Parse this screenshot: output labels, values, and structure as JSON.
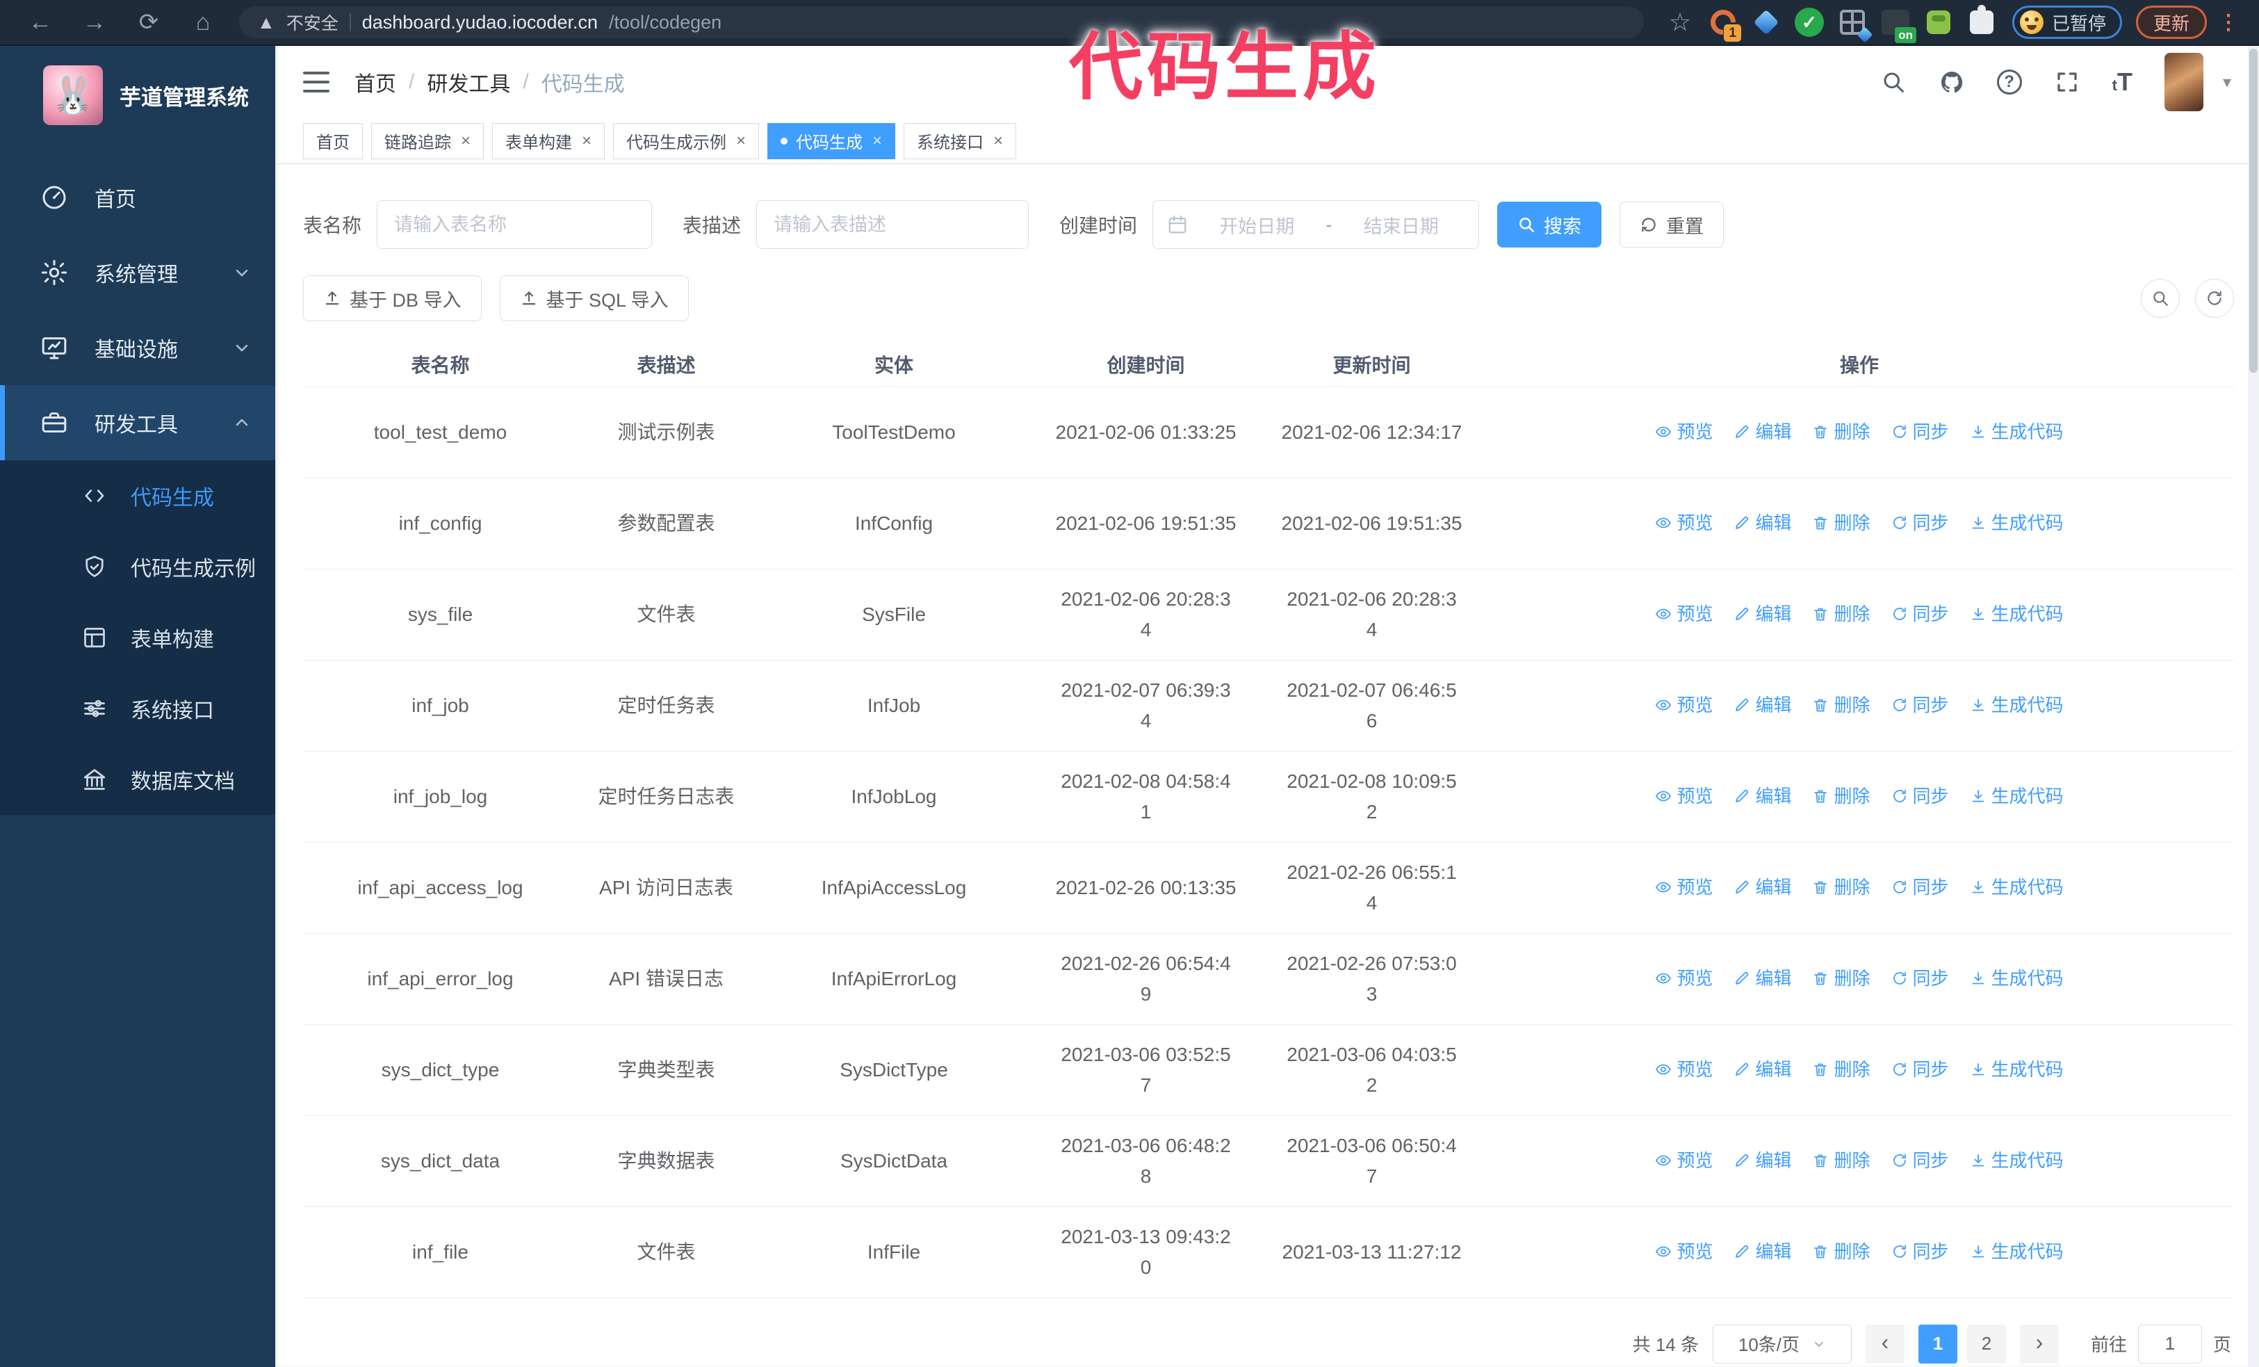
{
  "browser": {
    "security_label": "不安全",
    "url_host": "dashboard.yudao.iocoder.cn",
    "url_path": "/tool/codegen",
    "extension_badge_count": "1",
    "extension_badge_on": "on",
    "paused_badge_label": "已暂停",
    "update_button_label": "更新"
  },
  "overlay": {
    "title": "代码生成"
  },
  "sidebar": {
    "app_title": "芋道管理系统",
    "logo_glyph": "🐰",
    "items": [
      {
        "key": "home",
        "label": "首页",
        "icon": "dashboard-icon",
        "expandable": false
      },
      {
        "key": "system",
        "label": "系统管理",
        "icon": "gear-icon",
        "expandable": true
      },
      {
        "key": "infra",
        "label": "基础设施",
        "icon": "monitor-icon",
        "expandable": true
      },
      {
        "key": "devtools",
        "label": "研发工具",
        "icon": "toolbox-icon",
        "expandable": true,
        "expanded": true,
        "active": true
      }
    ],
    "sub_items": [
      {
        "key": "codegen",
        "label": "代码生成",
        "icon": "code-icon",
        "active": true
      },
      {
        "key": "codegen-example",
        "label": "代码生成示例",
        "icon": "shield-check-icon"
      },
      {
        "key": "form-builder",
        "label": "表单构建",
        "icon": "form-icon"
      },
      {
        "key": "system-api",
        "label": "系统接口",
        "icon": "sliders-icon"
      },
      {
        "key": "db-doc",
        "label": "数据库文档",
        "icon": "database-icon"
      }
    ]
  },
  "header": {
    "breadcrumb": [
      "首页",
      "研发工具",
      "代码生成"
    ],
    "breadcrumb_separator": "/"
  },
  "tabs": {
    "close_glyph": "×",
    "items": [
      {
        "key": "home",
        "label": "首页",
        "closable": false,
        "active": false
      },
      {
        "key": "tracer",
        "label": "链路追踪",
        "closable": true,
        "active": false
      },
      {
        "key": "form-builder",
        "label": "表单构建",
        "closable": true,
        "active": false
      },
      {
        "key": "codegen-example",
        "label": "代码生成示例",
        "closable": true,
        "active": false
      },
      {
        "key": "codegen",
        "label": "代码生成",
        "closable": true,
        "active": true
      },
      {
        "key": "system-api",
        "label": "系统接口",
        "closable": true,
        "active": false
      }
    ]
  },
  "filters": {
    "name_label": "表名称",
    "name_placeholder": "请输入表名称",
    "desc_label": "表描述",
    "desc_placeholder": "请输入表描述",
    "time_label": "创建时间",
    "start_placeholder": "开始日期",
    "range_separator": "-",
    "end_placeholder": "结束日期",
    "search_label": "搜索",
    "reset_label": "重置"
  },
  "toolbar": {
    "import_db_label": "基于 DB 导入",
    "import_sql_label": "基于 SQL 导入"
  },
  "table": {
    "columns": [
      "表名称",
      "表描述",
      "实体",
      "创建时间",
      "更新时间",
      "操作"
    ],
    "actions": [
      {
        "key": "preview",
        "label": "预览",
        "icon": "eye-icon"
      },
      {
        "key": "edit",
        "label": "编辑",
        "icon": "edit-icon"
      },
      {
        "key": "delete",
        "label": "删除",
        "icon": "delete-icon"
      },
      {
        "key": "sync",
        "label": "同步",
        "icon": "sync-icon"
      },
      {
        "key": "generate",
        "label": "生成代码",
        "icon": "download-icon"
      }
    ],
    "rows": [
      {
        "name": "tool_test_demo",
        "desc": "测试示例表",
        "entity": "ToolTestDemo",
        "created": "2021-02-06 01:33:25",
        "updated": "2021-02-06 12:34:17"
      },
      {
        "name": "inf_config",
        "desc": "参数配置表",
        "entity": "InfConfig",
        "created": "2021-02-06 19:51:35",
        "updated": "2021-02-06 19:51:35"
      },
      {
        "name": "sys_file",
        "desc": "文件表",
        "entity": "SysFile",
        "created": "2021-02-06 20:28:3\n4",
        "updated": "2021-02-06 20:28:3\n4"
      },
      {
        "name": "inf_job",
        "desc": "定时任务表",
        "entity": "InfJob",
        "created": "2021-02-07 06:39:3\n4",
        "updated": "2021-02-07 06:46:5\n6"
      },
      {
        "name": "inf_job_log",
        "desc": "定时任务日志表",
        "entity": "InfJobLog",
        "created": "2021-02-08 04:58:4\n1",
        "updated": "2021-02-08 10:09:5\n2"
      },
      {
        "name": "inf_api_access_log",
        "desc": "API 访问日志表",
        "entity": "InfApiAccessLog",
        "created": "2021-02-26 00:13:35",
        "updated": "2021-02-26 06:55:1\n4"
      },
      {
        "name": "inf_api_error_log",
        "desc": "API 错误日志",
        "entity": "InfApiErrorLog",
        "created": "2021-02-26 06:54:4\n9",
        "updated": "2021-02-26 07:53:0\n3"
      },
      {
        "name": "sys_dict_type",
        "desc": "字典类型表",
        "entity": "SysDictType",
        "created": "2021-03-06 03:52:5\n7",
        "updated": "2021-03-06 04:03:5\n2"
      },
      {
        "name": "sys_dict_data",
        "desc": "字典数据表",
        "entity": "SysDictData",
        "created": "2021-03-06 06:48:2\n8",
        "updated": "2021-03-06 06:50:4\n7"
      },
      {
        "name": "inf_file",
        "desc": "文件表",
        "entity": "InfFile",
        "created": "2021-03-13 09:43:2\n0",
        "updated": "2021-03-13 11:27:12"
      }
    ]
  },
  "pagination": {
    "total_label": "共 14 条",
    "page_size": "10条/页",
    "pages": [
      "1",
      "2"
    ],
    "active_page": "1",
    "prev_glyph": "‹",
    "next_glyph": "›",
    "goto_label": "前往",
    "goto_value": "1",
    "goto_suffix": "页"
  },
  "colors": {
    "primary": "#409eff",
    "overlay_pink": "#f43f63",
    "sidebar_bg": "#1d3a57",
    "submenu_bg": "#152d46",
    "browser_bar": "#202b39"
  }
}
